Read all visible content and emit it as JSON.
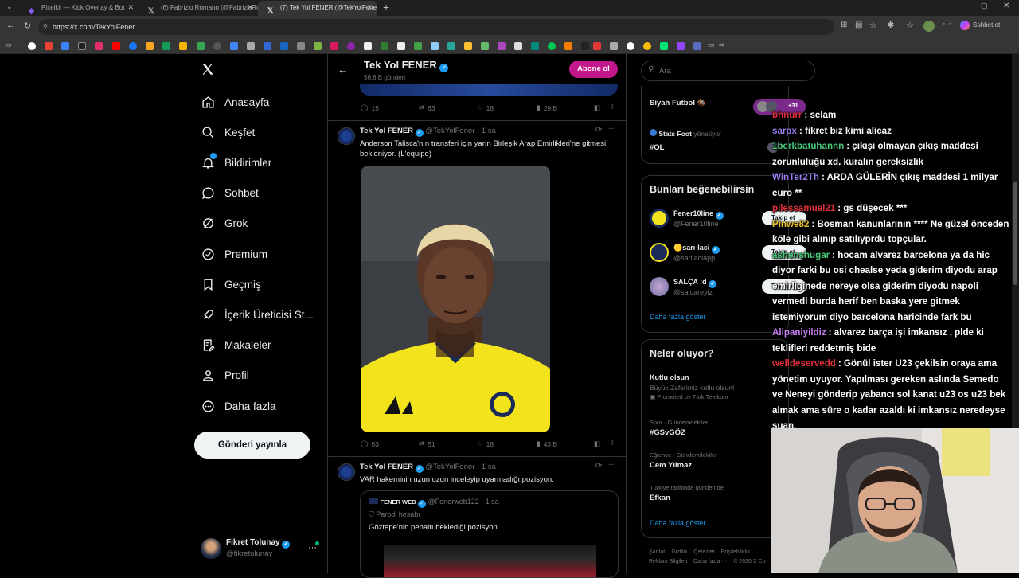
{
  "browser": {
    "tabs": [
      {
        "title": "Pixelkit — Kick Overlay & Bot",
        "active": false
      },
      {
        "title": "(6) Fabrizio Romano (@FabrizioRom…",
        "active": false
      },
      {
        "title": "(7) Tek Yol FENER (@TekYolFener)",
        "active": true
      }
    ],
    "url": "https://x.com/TekYolFener",
    "profile_button": "Sohbet et"
  },
  "nav": {
    "logo": "X",
    "items": [
      {
        "label": "Anasayfa",
        "icon": "home-icon"
      },
      {
        "label": "Keşfet",
        "icon": "search-icon"
      },
      {
        "label": "Bildirimler",
        "icon": "bell-icon"
      },
      {
        "label": "Sohbet",
        "icon": "chat-icon"
      },
      {
        "label": "Grok",
        "icon": "grok-icon"
      },
      {
        "label": "Premium",
        "icon": "premium-icon"
      },
      {
        "label": "Geçmiş",
        "icon": "bookmark-icon"
      },
      {
        "label": "İçerik Üreticisi St...",
        "icon": "rocket-icon"
      },
      {
        "label": "Makaleler",
        "icon": "article-icon"
      },
      {
        "label": "Profil",
        "icon": "person-icon"
      },
      {
        "label": "Daha fazla",
        "icon": "more-icon"
      }
    ],
    "post_button": "Gönderi yayınla",
    "account": {
      "name": "Fikret Tolunay",
      "handle": "@fikretolunay"
    }
  },
  "profile_header": {
    "name": "Tek Yol FENER",
    "posts_count": "56,8 B gönderi",
    "subscribe_label": "Abone ol"
  },
  "prev_post_stats": {
    "replies": "15",
    "reposts": "63",
    "likes": "18",
    "views": "29 B"
  },
  "posts": [
    {
      "author": "Tek Yol FENER",
      "handle": "@TekYolFener",
      "time": "· 1 sa",
      "text": "Anderson Talisca'nın transferi için yarın Birleşik Arap Emirlikleri'ne gitmesi bekleniyor. (L'equipe)",
      "stats": {
        "replies": "53",
        "reposts": "51",
        "likes": "18",
        "views": "43 B"
      }
    },
    {
      "author": "Tek Yol FENER",
      "handle": "@TekYolFener",
      "time": "· 1 sa",
      "text": "VAR hakeminin uzun uzun inceleyip uyarmadığı pozisyon.",
      "quote": {
        "author": "FENER WEB",
        "handle": "@Fenerweb122",
        "time": "· 1 sa",
        "label": "Parodi hesabı",
        "text": "Göztepe'nin penaltı beklediği pozisyon."
      }
    }
  ],
  "right": {
    "search_placeholder": "Ara",
    "spaces": [
      {
        "title": "Siyah Futbol 🏇",
        "count": "+31"
      },
      {
        "title": "Stats Foot",
        "sub": "yönetiyor",
        "tag": "#OL"
      }
    ],
    "suggest_title": "Bunları beğenebilirsin",
    "suggestions": [
      {
        "name": "Fener10line",
        "handle": "@Fener10line",
        "follow": "Takip et"
      },
      {
        "name": "🟡sarı-laci",
        "handle": "@sarilaciapp",
        "follow": "Takip et"
      },
      {
        "name": "SALÇA :d",
        "handle": "@salcareyiz",
        "follow": "Takip et"
      }
    ],
    "show_more": "Daha fazla göster",
    "trends_title": "Neler oluyor?",
    "trends": [
      {
        "title": "Kutlu olsun",
        "sub": "Büyük Zaferimiz kutlu olsun!",
        "meta": "Promoted by Türk Telekom"
      },
      {
        "meta": "Spor · Gündemdekiler",
        "title": "#GSvGÖZ"
      },
      {
        "meta": "Eğlence · Gündemdekiler",
        "title": "Cem Yılmaz"
      },
      {
        "meta": "Türkiye tarihinde gündemde",
        "title": "Efkan"
      }
    ],
    "footer_links": [
      "Şartlar",
      "Gizlilik",
      "Çerezler",
      "Erişilebilirlik",
      "Reklam Bilgileri",
      "Daha fazla ···",
      "© 2026 X Co"
    ]
  },
  "chat": [
    {
      "user": "bhnurr",
      "color": "#e0303a",
      "msg": ": selam"
    },
    {
      "user": "sarpx",
      "color": "#9b7cf0",
      "msg": ": fikret biz kimi alicaz"
    },
    {
      "user": "1berkbatuhannn",
      "color": "#49c97a",
      "msg": ": çıkışı olmayan çıkış maddesi zorunluluğu xd. kuralın gereksizlik"
    },
    {
      "user": "WinTer2Th",
      "color": "#9b7cf0",
      "msg": ": ARDA GÜLERİN çıkış maddesi 1 milyar euro **"
    },
    {
      "user": "pilessamuel21",
      "color": "#e0303a",
      "msg": ": gs düşecek ***"
    },
    {
      "user": "Pinwe82",
      "color": "#e7c130",
      "msg": ": Bosman kanunlarının **** Ne güzel önceden köle gibi alınıp satılıyprdu topçular."
    },
    {
      "user": "ashenshugar",
      "color": "#49c97a",
      "msg": ": hocam alvarez barcelona ya da hic diyor farki bu osi chealse yeda giderim diyodu arap emirliginede nereye olsa giderim diyodu napoli vermedi burda herif ben baska yere gitmek istemiyorum diyo barcelona haricinde fark bu"
    },
    {
      "user": "Alipaniyildiz",
      "color": "#c47cf0",
      "msg": ": alvarez barça işi imkansız , plde ki teklifleri reddetmiş bide"
    },
    {
      "user": "welldeservedd",
      "color": "#e0303a",
      "msg": ": Gönül ister U23 çekilsin oraya ama yönetim uyuyor. Yapılması gereken aslında Semedo ve Neneyi gönderip yabancı sol kanat u23 os u23 bek almak ama süre o kadar azaldı ki imkansız neredeyse şuan."
    }
  ],
  "colors": {
    "accent": "#1d9bf0",
    "subscribe": "#c2188b",
    "bg": "#000000",
    "border": "#2f3336",
    "muted": "#71767b"
  }
}
